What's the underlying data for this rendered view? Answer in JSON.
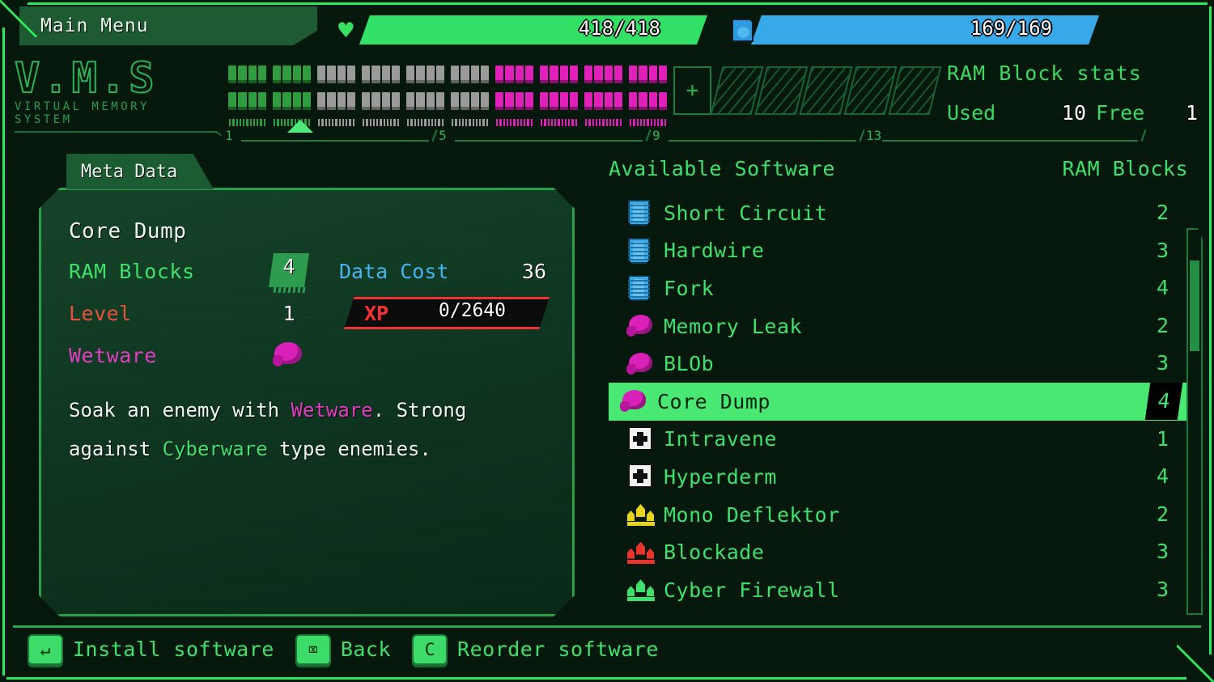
{
  "window": {
    "menu_tab_label": "Main Menu"
  },
  "hud": {
    "health": {
      "icon": "heart-icon",
      "current": 418,
      "max": 418,
      "text": "418/418",
      "color": "#33e066"
    },
    "data": {
      "icon": "disk-icon",
      "current": 169,
      "max": 169,
      "text": "169/169",
      "color": "#37a8e8"
    }
  },
  "logo": {
    "big": "V.M.S",
    "small": "VIRTUAL MEMORY SYSTEM"
  },
  "ram_strip": {
    "slots": [
      {
        "state": "filled",
        "color": "#2e9c3f"
      },
      {
        "state": "filled",
        "color": "#2e9c3f"
      },
      {
        "state": "filled",
        "color": "#9a9a9a"
      },
      {
        "state": "filled",
        "color": "#9a9a9a"
      },
      {
        "state": "filled",
        "color": "#9a9a9a"
      },
      {
        "state": "filled",
        "color": "#9a9a9a"
      },
      {
        "state": "filled",
        "color": "#e020b8"
      },
      {
        "state": "filled",
        "color": "#e020b8"
      },
      {
        "state": "filled",
        "color": "#e020b8"
      },
      {
        "state": "filled",
        "color": "#e020b8"
      },
      {
        "state": "free",
        "color": "#25b24f",
        "label": "+"
      },
      {
        "state": "locked",
        "color": "#249648"
      },
      {
        "state": "locked",
        "color": "#249648"
      },
      {
        "state": "locked",
        "color": "#249648"
      },
      {
        "state": "locked",
        "color": "#249648"
      },
      {
        "state": "locked",
        "color": "#249648"
      }
    ],
    "ruler_marks": [
      "1",
      "5",
      "9",
      "13"
    ],
    "cursor_slot_index": 9
  },
  "ram_stats": {
    "title": "RAM Block stats",
    "used_label": "Used",
    "used_value": "10",
    "free_label": "Free",
    "free_value": "1"
  },
  "meta": {
    "tab_label": "Meta Data",
    "title": "Core Dump",
    "ram_blocks_label": "RAM Blocks",
    "ram_blocks_value": "4",
    "data_cost_label": "Data Cost",
    "data_cost_value": "36",
    "level_label": "Level",
    "level_value": "1",
    "xp_label": "XP",
    "xp_value": "0/2640",
    "xp_current": 0,
    "xp_max": 2640,
    "type_label": "Wetware",
    "type_icon": "brain-icon",
    "description_parts": {
      "a": "Soak an enemy with ",
      "wetware": "Wetware",
      "b": ". Strong against ",
      "cyberware": "Cyberware",
      "c": " type enemies."
    }
  },
  "software": {
    "header_name": "Available Software",
    "header_blocks": "RAM Blocks",
    "items": [
      {
        "icon": "chip-icon",
        "name": "Short Circuit",
        "blocks": "2",
        "selected": false
      },
      {
        "icon": "chip-icon",
        "name": "Hardwire",
        "blocks": "3",
        "selected": false
      },
      {
        "icon": "chip-icon",
        "name": "Fork",
        "blocks": "4",
        "selected": false
      },
      {
        "icon": "brain-icon",
        "name": "Memory Leak",
        "blocks": "2",
        "selected": false
      },
      {
        "icon": "brain-icon",
        "name": "BLOb",
        "blocks": "3",
        "selected": false
      },
      {
        "icon": "brain-icon",
        "name": "Core Dump",
        "blocks": "4",
        "selected": true
      },
      {
        "icon": "medkit-icon",
        "name": "Intravene",
        "blocks": "1",
        "selected": false
      },
      {
        "icon": "medkit-icon",
        "name": "Hyperderm",
        "blocks": "4",
        "selected": false
      },
      {
        "icon": "shield-icon",
        "name": "Mono Deflektor",
        "blocks": "2",
        "selected": false,
        "icon_color": "#e8d41c"
      },
      {
        "icon": "shield-icon",
        "name": "Blockade",
        "blocks": "3",
        "selected": false,
        "icon_color": "#e8342c"
      },
      {
        "icon": "shield-icon",
        "name": "Cyber Firewall",
        "blocks": "3",
        "selected": false,
        "icon_color": "#3fe06c"
      }
    ]
  },
  "actions": [
    {
      "key": "↵",
      "key_name": "enter-key",
      "label": "Install software"
    },
    {
      "key": "⌧",
      "key_name": "backspace-key",
      "label": "Back"
    },
    {
      "key": "C",
      "key_name": "c-key",
      "label": "Reorder software"
    }
  ],
  "colors": {
    "accent_green": "#3fe06c",
    "panel_bg": "#0e3520",
    "magenta": "#e23ec2",
    "blue": "#45b4f0",
    "red": "#ef3333"
  }
}
